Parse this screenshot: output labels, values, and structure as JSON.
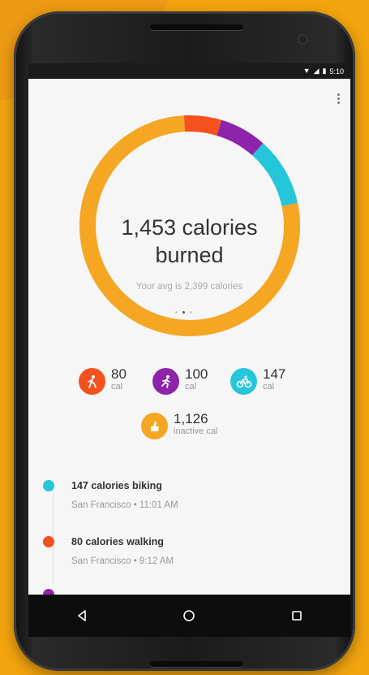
{
  "status_bar": {
    "time": "5:10",
    "icons": [
      "wifi-icon",
      "signal-icon",
      "battery-icon"
    ]
  },
  "summary": {
    "headline_line1": "1,453 calories",
    "headline_line2": "burned",
    "average": "Your avg is 2,399 calories"
  },
  "ring": {
    "segments": [
      {
        "activity": "walking",
        "fraction": 0.055,
        "color": "#f4511e"
      },
      {
        "activity": "running",
        "fraction": 0.069,
        "color": "#8e24aa"
      },
      {
        "activity": "biking",
        "fraction": 0.101,
        "color": "#26c6da"
      },
      {
        "activity": "inactive",
        "fraction": 0.775,
        "color": "#f5a623"
      }
    ],
    "track_color": "#e4e4e4"
  },
  "stats": [
    {
      "value": "80",
      "unit": "cal",
      "icon": "walking-icon",
      "color": "#f4511e"
    },
    {
      "value": "100",
      "unit": "cal",
      "icon": "running-icon",
      "color": "#8e24aa"
    },
    {
      "value": "147",
      "unit": "cal",
      "icon": "biking-icon",
      "color": "#26c6da"
    },
    {
      "value": "1,126",
      "unit": "inactive cal",
      "icon": "inactive-icon",
      "color": "#f5a623"
    }
  ],
  "timeline": [
    {
      "title": "147 calories biking",
      "subtitle": "San Francisco • 11:01 AM",
      "color": "#26c6da"
    },
    {
      "title": "80 calories walking",
      "subtitle": "San Francisco • 9:12 AM",
      "color": "#f4511e"
    },
    {
      "title": "",
      "subtitle": "",
      "color": "#8e24aa"
    }
  ],
  "nav": {
    "back": "back-icon",
    "home": "home-icon",
    "recents": "recents-icon"
  }
}
